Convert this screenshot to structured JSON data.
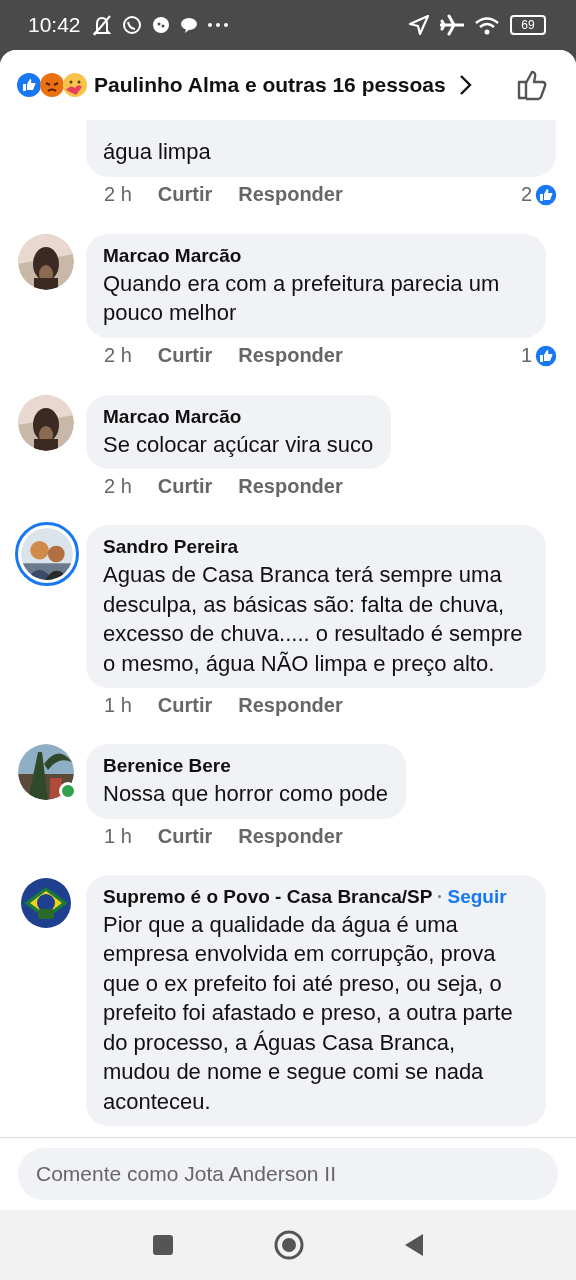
{
  "status_bar": {
    "time": "10:42",
    "battery": "69"
  },
  "header": {
    "reactors": "Paulinho Alma e outras 16 pessoas"
  },
  "comments": [
    {
      "text": "água limpa",
      "time": "2 h",
      "like": "Curtir",
      "reply": "Responder",
      "reactions": "2",
      "cut_top": true
    },
    {
      "name": "Marcao Marcão",
      "text": "Quando era com a prefeitura parecia um pouco melhor",
      "time": "2 h",
      "like": "Curtir",
      "reply": "Responder",
      "reactions": "1",
      "online": false,
      "story": false
    },
    {
      "name": "Marcao Marcão",
      "text": "Se colocar açúcar vira suco",
      "time": "2 h",
      "like": "Curtir",
      "reply": "Responder",
      "online": false,
      "story": false
    },
    {
      "name": "Sandro Pereira",
      "text": "Aguas de Casa Branca terá sempre uma desculpa, as básicas são: falta de chuva, excesso de chuva..... o resultado é sempre o mesmo, água NÃO limpa e preço alto.",
      "time": "1 h",
      "like": "Curtir",
      "reply": "Responder",
      "online": false,
      "story": true
    },
    {
      "name": "Berenice Bere",
      "text": "Nossa que horror como pode",
      "time": "1 h",
      "like": "Curtir",
      "reply": "Responder",
      "online": true,
      "story": false
    },
    {
      "name": "Supremo é o Povo - Casa Branca/SP",
      "follow": "Seguir",
      "text": "Pior que a qualidade da água é uma empresa envolvida em corrupção, prova que o ex prefeito foi até preso, ou seja, o prefeito foi afastado e preso, a outra parte do processo, a Águas Casa Branca, mudou de nome e segue comi se nada aconteceu.",
      "online": false,
      "story": false
    }
  ],
  "composer": {
    "placeholder": "Comente como Jota Anderson II"
  }
}
